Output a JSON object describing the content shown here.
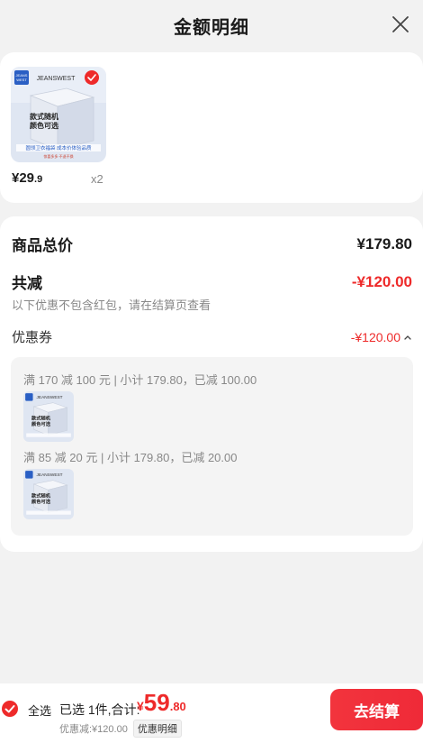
{
  "header": {
    "title": "金额明细",
    "close_icon": "close-icon"
  },
  "product": {
    "image": {
      "brand": "JEANSWEST",
      "badge": "JEANS WEST",
      "box_lines": [
        "款式随机",
        "颜色可选"
      ],
      "strip_text": "圆领卫衣福袋 成本价体验品质",
      "small_text": "惊喜多多·不退不换",
      "colors": {
        "bg": "#dfe6f2",
        "brand_blue": "#2a5fc4",
        "check": "#ee2a2a"
      }
    },
    "price_symbol": "¥",
    "price_int": "29",
    "price_dec": ".9",
    "qty": "x2"
  },
  "breakdown": {
    "total_label": "商品总价",
    "total_value": "¥179.80",
    "reduce_label": "共减",
    "reduce_value": "-¥120.00",
    "note": "以下优惠不包含红包，请在结算页查看",
    "coupon_label": "优惠券",
    "coupon_value": "-¥120.00",
    "coupons": [
      {
        "text": "满 170 减 100 元 | 小计 179.80，已减 100.00"
      },
      {
        "text": "满 85 减 20 元 | 小计 179.80，已减 20.00"
      }
    ]
  },
  "bottom": {
    "select_all": "全选",
    "summary": "已选 1件,合计:",
    "total_symbol": "¥",
    "total_int": "59",
    "total_dec": ".80",
    "discount_text": "优惠减:¥120.00",
    "detail_label": "优惠明细",
    "checkout_label": "去结算"
  },
  "colors": {
    "accent": "#ee2a2a",
    "page_bg": "#f2f2f2",
    "card_bg": "#ffffff"
  }
}
